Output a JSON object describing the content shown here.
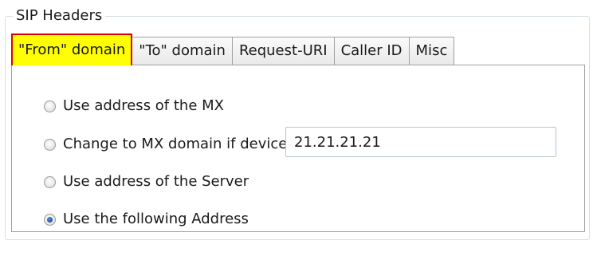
{
  "group": {
    "title": "SIP Headers"
  },
  "tabs": [
    {
      "label": "\"From\" domain",
      "active": true
    },
    {
      "label": "\"To\" domain",
      "active": false
    },
    {
      "label": "Request-URI",
      "active": false
    },
    {
      "label": "Caller ID",
      "active": false
    },
    {
      "label": "Misc",
      "active": false
    }
  ],
  "options": [
    {
      "label": "Use address of the MX",
      "checked": false
    },
    {
      "label": "Change to MX domain if device belongs to user",
      "checked": false
    },
    {
      "label": "Use address of the Server",
      "checked": false
    },
    {
      "label": "Use the following Address",
      "checked": true
    }
  ],
  "address": {
    "value": "21.21.21.21"
  },
  "colors": {
    "active_tab_bg": "#ffff00",
    "active_tab_border": "#e00000",
    "radio_selected": "#1d4f9a"
  }
}
